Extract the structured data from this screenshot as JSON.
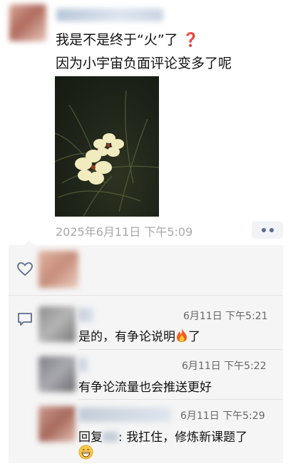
{
  "post": {
    "text_line1": "我是不是终于“火”了",
    "question_mark": "❓",
    "text_line2": "因为小宇宙负面评论变多了呢",
    "timestamp": "2025年6月11日 下午5:09",
    "more_icon": "more-dots-icon"
  },
  "likes": {
    "icon": "heart-outline-icon"
  },
  "comments": {
    "icon": "comment-bubble-icon",
    "items": [
      {
        "time": "6月11日 下午5:21",
        "text": "是的，有争论说明",
        "suffix": "了",
        "emoji": "fire-emoji"
      },
      {
        "time": "6月11日 下午5:22",
        "text": "有争论流量也会推送更好"
      },
      {
        "time": "6月11日 下午5:29",
        "reply_prefix": "回复",
        "text": ": 我扛住，修炼新课题了",
        "emoji": "grin-emoji"
      }
    ]
  },
  "colors": {
    "meta": "#a8a8a8",
    "panel": "#f5f5f5",
    "accent_dots": "#5a6d8c",
    "question": "#e02020"
  }
}
